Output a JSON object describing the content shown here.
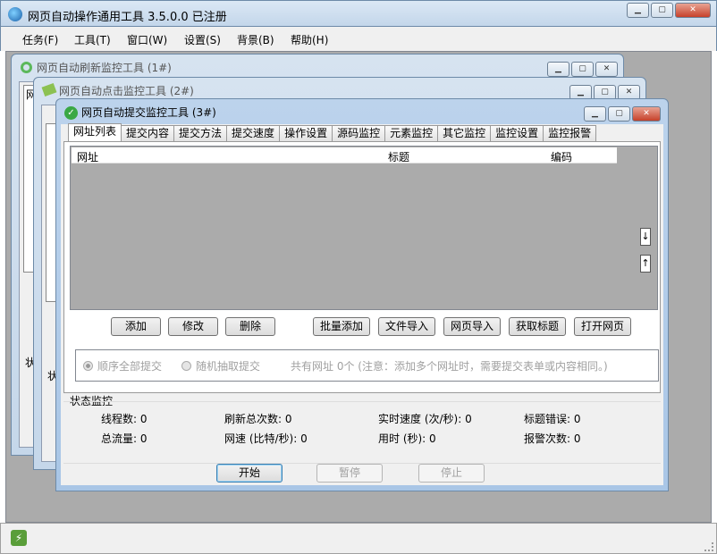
{
  "app": {
    "title": "网页自动操作通用工具 3.5.0.0  已注册"
  },
  "menu": [
    "任务(F)",
    "工具(T)",
    "窗口(W)",
    "设置(S)",
    "背景(B)",
    "帮助(H)"
  ],
  "windows": {
    "w1": "网页自动刷新监控工具  (1#)",
    "w2": "网页自动点击监控工具  (2#)",
    "w3": "网页自动提交监控工具  (3#)"
  },
  "tabs": [
    "网址列表",
    "提交内容",
    "提交方法",
    "提交速度",
    "操作设置",
    "源码监控",
    "元素监控",
    "其它监控",
    "监控设置",
    "监控报警"
  ],
  "list": {
    "columns": [
      "网址",
      "标题",
      "编码"
    ]
  },
  "buttons": {
    "add": "添加",
    "edit": "修改",
    "delete": "删除",
    "batch_add": "批量添加",
    "file_import": "文件导入",
    "web_import": "网页导入",
    "get_title": "获取标题",
    "open_page": "打开网页",
    "start": "开始",
    "pause": "暂停",
    "stop": "停止"
  },
  "mode": {
    "seq": "顺序全部提交",
    "random": "随机抽取提交",
    "note": "共有网址  0个  (注意：添加多个网址时，需要提交表单或内容相同。)"
  },
  "stats": {
    "title": "状态监控",
    "threads": "线程数:  0",
    "refresh_total": "刷新总次数:  0",
    "speed": "实时速度 (次/秒):  0",
    "title_errors": "标题错误:   0",
    "traffic": "总流量:  0",
    "net_speed": "网速 (比特/秒):  0",
    "elapsed": "用时 (秒):   0",
    "alarms": "报警次数:   0"
  },
  "bg_labels": {
    "a": "状",
    "b": "状",
    "c": "网"
  }
}
